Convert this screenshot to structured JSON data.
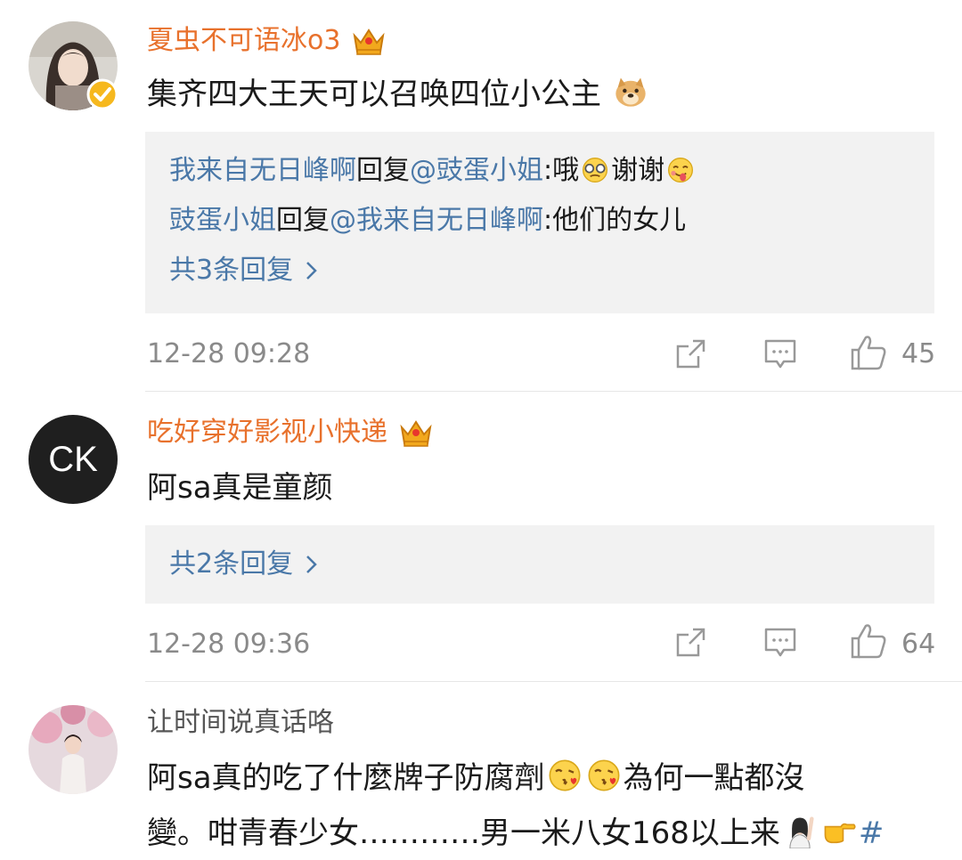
{
  "comments": [
    {
      "username": "夏虫不可语冰o3",
      "text": "集齐四大王天可以召唤四位小公主",
      "text_emoji": "doge-emoji",
      "replies": [
        {
          "from": "我来自无日峰啊",
          "verb": "回复",
          "to": "@豉蛋小姐",
          "text_a": ":哦",
          "text_b": "谢谢"
        },
        {
          "from": "豉蛋小姐",
          "verb": "回复",
          "to": "@我来自无日峰啊",
          "text_a": ":他们的女儿",
          "text_b": ""
        }
      ],
      "more_replies": "共3条回复",
      "time": "12-28 09:28",
      "likes": "45"
    },
    {
      "username": "吃好穿好影视小快递",
      "avatar_text": "CK",
      "text": "阿sa真是童颜",
      "more_replies": "共2条回复",
      "time": "12-28 09:36",
      "likes": "64"
    },
    {
      "username": "让时间说真话咯",
      "text_line1_a": "阿sa真的吃了什麼牌子防腐劑",
      "text_line1_b": "為何一點都沒",
      "text_line2_a": "變。咁青春少女…………男一米八女168以上来",
      "text_line2_b": "#"
    }
  ],
  "colors": {
    "vip_name": "#e8712c",
    "link": "#4a78a8",
    "meta": "#8a8a8a",
    "reply_bg": "#f2f2f2"
  },
  "icons": [
    "crown-icon",
    "verified-badge-icon",
    "share-icon",
    "comment-icon",
    "like-icon",
    "chevron-right-icon"
  ]
}
